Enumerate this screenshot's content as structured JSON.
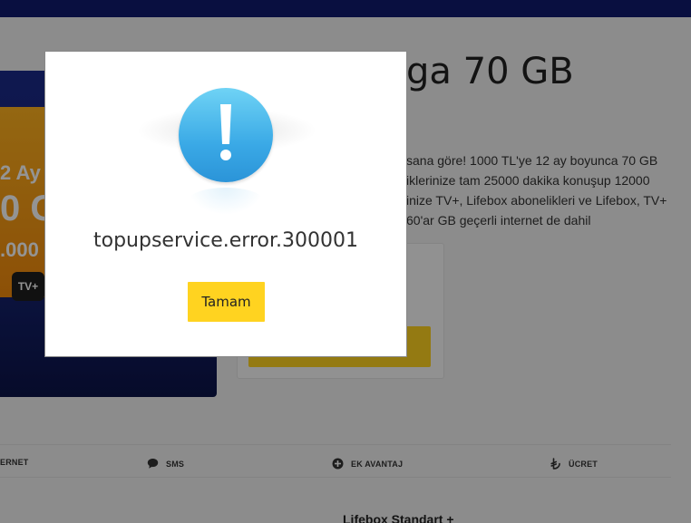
{
  "page": {
    "title_partial": "ga 70 GB",
    "description_lines": [
      "sana göre! 1000 TL'ye 12 ay boyunca 70 GB",
      "iklerinize tam 25000 dakika konuşup 12000",
      "inize TV+, Lifebox abonelikleri ve Lifebox, TV+",
      "60'ar GB geçerli internet de dahil"
    ]
  },
  "banner": {
    "text_1": "2 Ay",
    "text_2": "0 G",
    "text_3": ".000",
    "tv_label": "TV+"
  },
  "tabs": [
    {
      "label": "ERNET",
      "icon": "globe-icon"
    },
    {
      "label": "SMS",
      "icon": "chat-bubble-icon"
    },
    {
      "label": "EK AVANTAJ",
      "icon": "plus-circle-icon"
    },
    {
      "label": "ÜCRET",
      "icon": "lira-icon"
    }
  ],
  "section_heading": "Lifebox Standart +",
  "modal": {
    "icon": "exclamation-icon",
    "message": "topupservice.error.300001",
    "button_label": "Tamam"
  },
  "colors": {
    "top_bar": "#101a6e",
    "accent_yellow": "#ffd320",
    "alert_blue": "#3aa9e6"
  }
}
